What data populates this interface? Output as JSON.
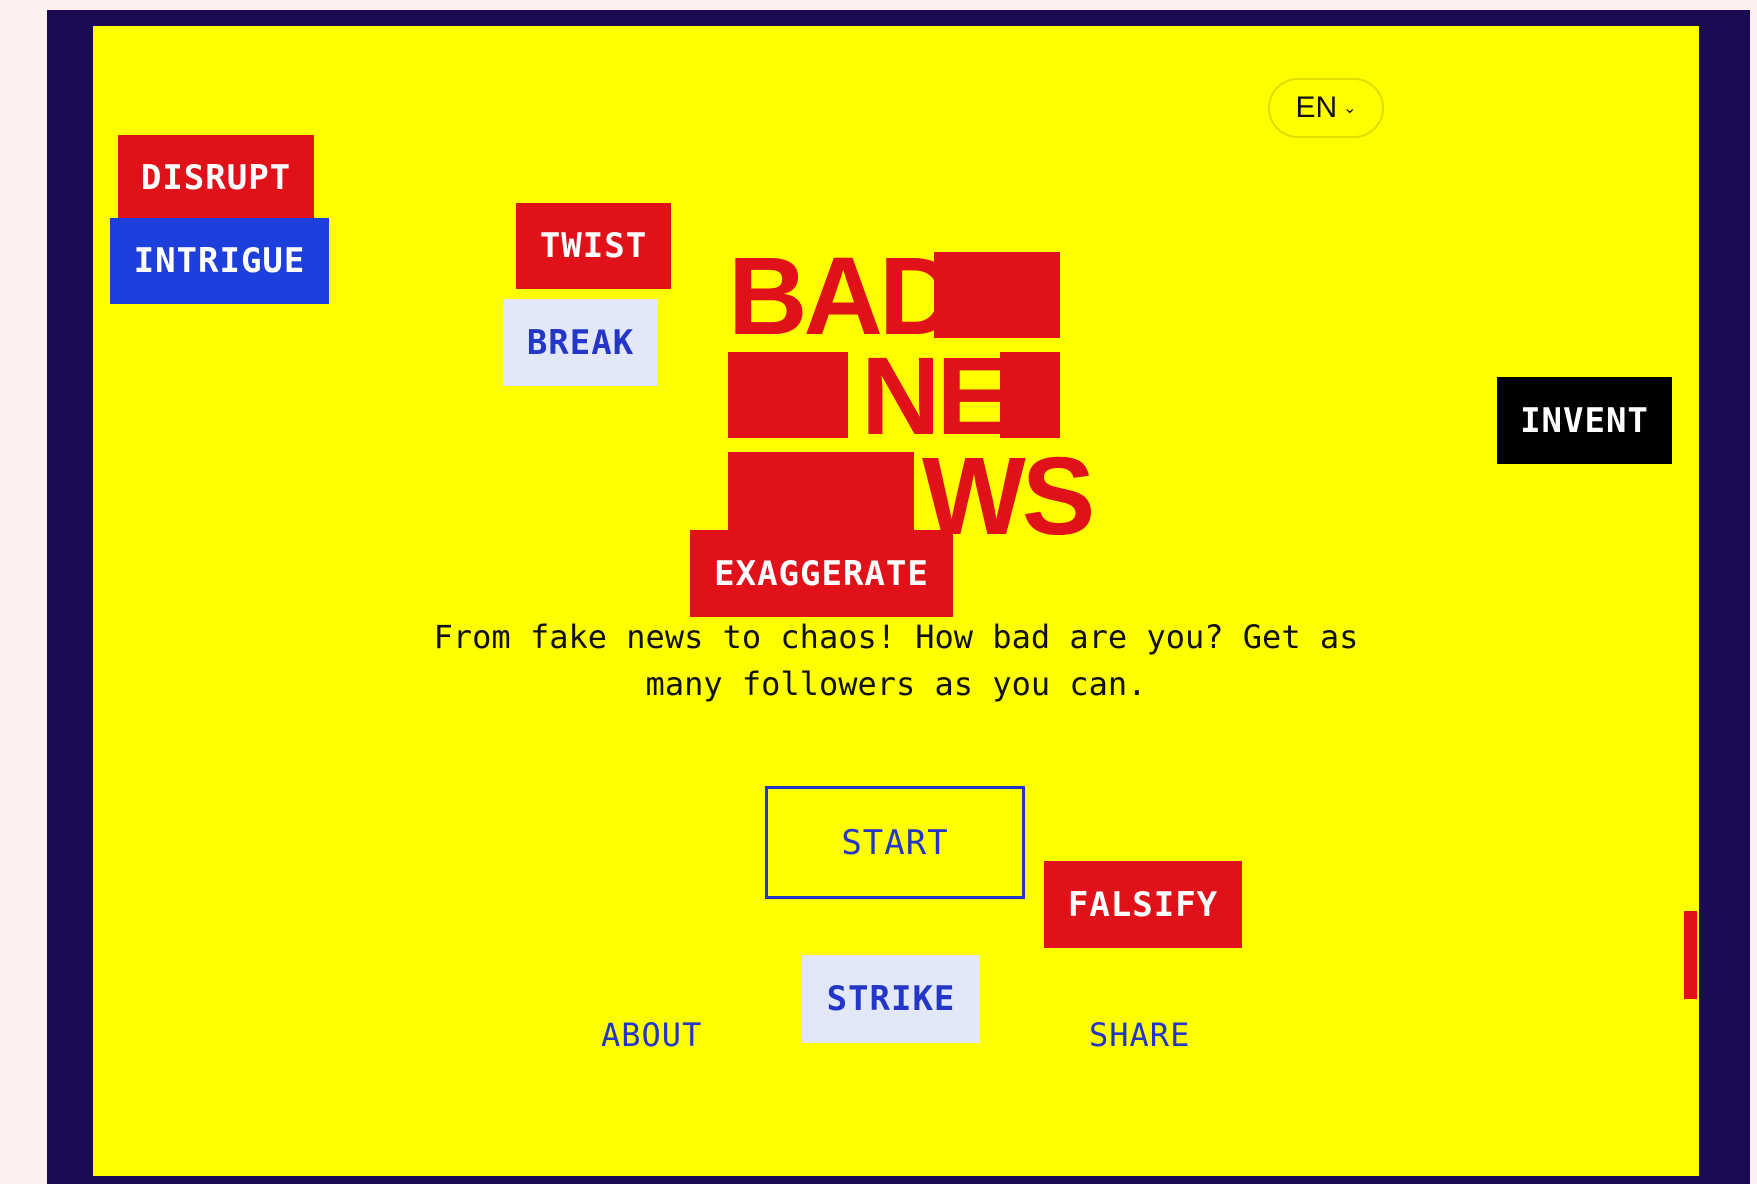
{
  "language_selector": {
    "value": "EN",
    "icon": "chevron-down-icon"
  },
  "tags": {
    "disrupt": "DISRUPT",
    "intrigue": "INTRIGUE",
    "twist": "TWIST",
    "break": "BREAK",
    "invent": "INVENT",
    "exaggerate": "EXAGGERATE",
    "falsify": "FALSIFY",
    "strike": "STRIKE"
  },
  "logo": {
    "line1": "BAD",
    "line2": "NE",
    "line3": "WS"
  },
  "subtitle": "From fake news to chaos! How bad are you? Get as many followers as you can.",
  "start_label": "START",
  "footer": {
    "about": "ABOUT",
    "share": "SHARE"
  },
  "colors": {
    "background": "#ffff00",
    "frame": "#1a0b52",
    "accent_red": "#e01119",
    "accent_blue": "#1d3fdb",
    "link_blue": "#2336c8",
    "pale_tag": "#e3e8f8"
  }
}
